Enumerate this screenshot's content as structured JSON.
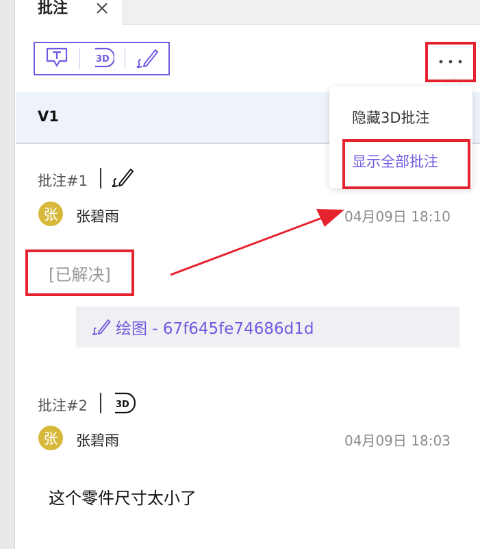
{
  "panel": {
    "tab_label": "批注",
    "close_icon": "close-icon",
    "version_label": "V1"
  },
  "toolbar": {
    "text_note_icon": "text-note-icon",
    "note_3d_icon": "3d-note-icon",
    "pen_icon": "pen-icon",
    "more_icon": "more-dots-icon"
  },
  "menu": {
    "items": [
      {
        "label": "隐藏3D批注"
      },
      {
        "label": "显示全部批注"
      }
    ]
  },
  "notes": [
    {
      "title": "批注#1",
      "type_icon": "pen-icon",
      "author": "张碧雨",
      "avatar_char": "张",
      "time": "04月09日 18:10",
      "status": "[已解决]",
      "attachment": "绘图 - 67f645fe74686d1d"
    },
    {
      "title": "批注#2",
      "type_icon": "3d-note-icon",
      "author": "张碧雨",
      "avatar_char": "张",
      "time": "04月09日 18:03",
      "content": "这个零件尺寸太小了"
    }
  ],
  "colors": {
    "accent": "#6f5be0",
    "highlight": "#e4232e",
    "avatar": "#d6b83a",
    "version_bar": "#eef2fb"
  }
}
